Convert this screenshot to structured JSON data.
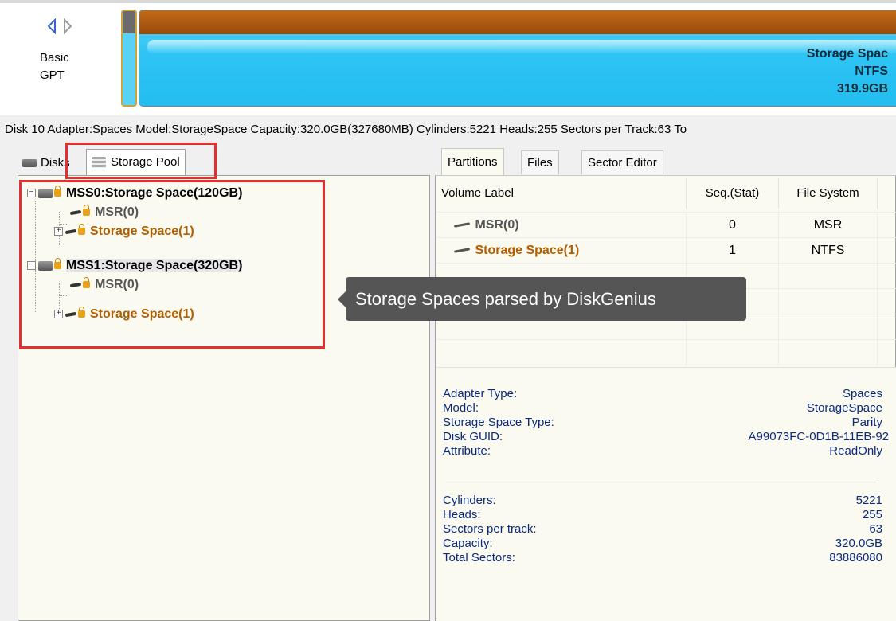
{
  "disk_header": {
    "type_line1": "Basic",
    "type_line2": "GPT",
    "partition_name": "Storage Spac",
    "partition_fs": "NTFS",
    "partition_size": "319.9GB"
  },
  "disk_info": "Disk 10 Adapter:Spaces  Model:StorageSpace  Capacity:320.0GB(327680MB)  Cylinders:5221  Heads:255  Sectors per Track:63  To",
  "left_tabs": {
    "disks": "Disks",
    "storage_pool": "Storage Pool"
  },
  "tree": [
    {
      "label": "MSS0:Storage Space(120GB)",
      "kind": "pool"
    },
    {
      "label": "MSR(0)",
      "kind": "msr"
    },
    {
      "label": "Storage Space(1)",
      "kind": "space"
    },
    {
      "label": "MSS1:Storage Space(320GB)",
      "kind": "pool"
    },
    {
      "label": "MSR(0)",
      "kind": "msr"
    },
    {
      "label": "Storage Space(1)",
      "kind": "space"
    }
  ],
  "right_tabs": {
    "partitions": "Partitions",
    "files": "Files",
    "sector_editor": "Sector Editor"
  },
  "grid": {
    "headers": {
      "volume_label": "Volume Label",
      "seq": "Seq.(Stat)",
      "fs": "File System"
    },
    "rows": [
      {
        "label": "MSR(0)",
        "seq": "0",
        "fs": "MSR"
      },
      {
        "label": "Storage Space(1)",
        "seq": "1",
        "fs": "NTFS"
      }
    ]
  },
  "props_top": [
    {
      "key": "Adapter Type:",
      "value": "Spaces"
    },
    {
      "key": "Model:",
      "value": "StorageSpace"
    },
    {
      "key": "Storage Space Type:",
      "value": "Parity"
    },
    {
      "key": "Disk GUID:",
      "value": "A99073FC-0D1B-11EB-92"
    },
    {
      "key": "Attribute:",
      "value": "ReadOnly"
    }
  ],
  "props_bottom": [
    {
      "key": "Cylinders:",
      "value": "5221"
    },
    {
      "key": "Heads:",
      "value": "255"
    },
    {
      "key": "Sectors per track:",
      "value": "63"
    },
    {
      "key": "Capacity:",
      "value": "320.0GB"
    },
    {
      "key": "Total Sectors:",
      "value": "83886080"
    }
  ],
  "tooltip": "Storage Spaces parsed by DiskGenius",
  "colors": {
    "highlight_frame": "#e03030",
    "storage_space_text": "#b05e00",
    "prop_text": "#0b2a80",
    "partition_fill": "#2fc4f4",
    "partition_top": "#a8520e"
  }
}
